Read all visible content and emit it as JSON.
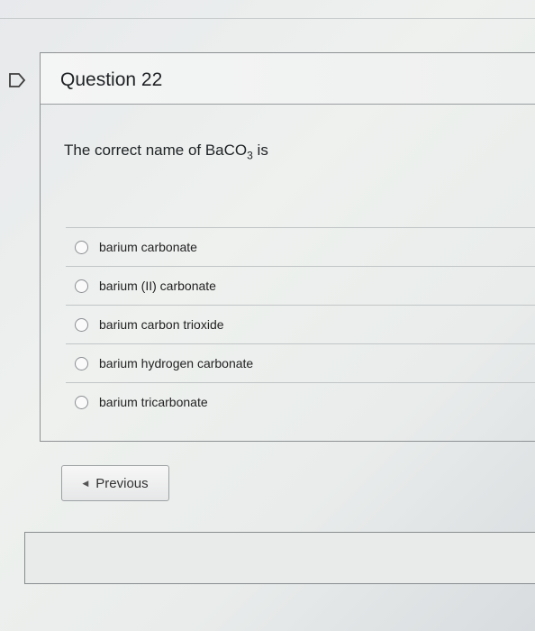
{
  "question": {
    "title": "Question 22",
    "prompt_prefix": "The correct name of BaCO",
    "prompt_sub": "3",
    "prompt_suffix": " is",
    "options": [
      "barium carbonate",
      "barium (II) carbonate",
      "barium carbon trioxide",
      "barium hydrogen carbonate",
      "barium tricarbonate"
    ]
  },
  "nav": {
    "previous_label": "Previous"
  }
}
